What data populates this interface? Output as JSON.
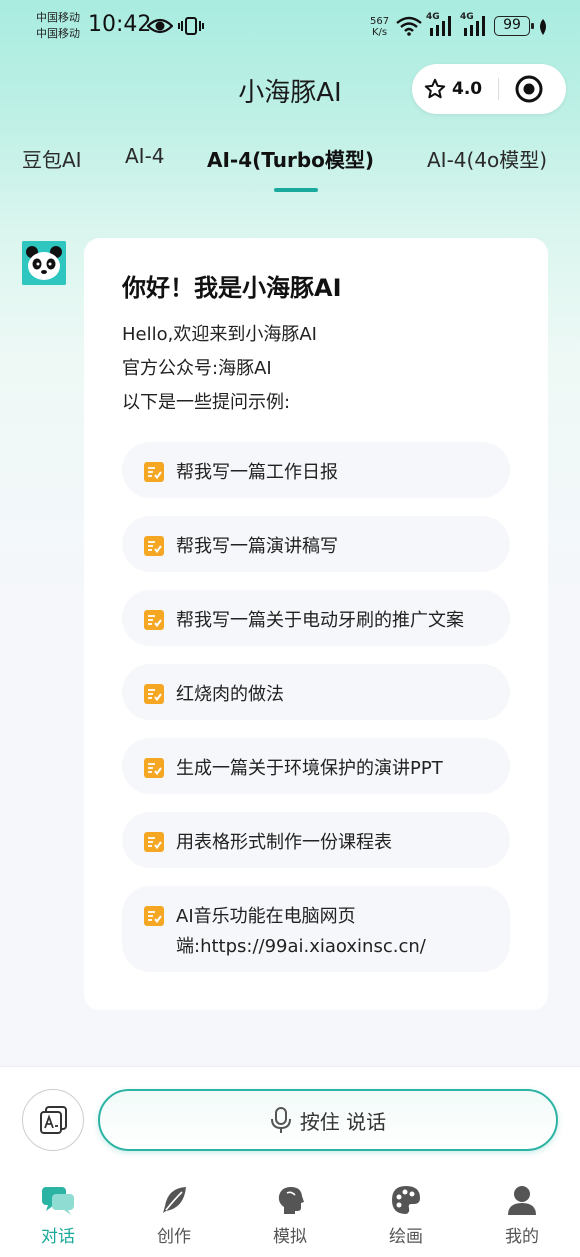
{
  "status_bar": {
    "carrier_1": "中国移动",
    "carrier_2": "中国移动",
    "time": "10:42",
    "net_speed_value": "567",
    "net_speed_unit": "K/s",
    "net_type_1": "4G",
    "net_type_2": "4G",
    "battery": "99"
  },
  "header": {
    "title": "小海豚AI",
    "rating": "4.0"
  },
  "tabs": [
    {
      "label": "豆包AI"
    },
    {
      "label": "AI-4"
    },
    {
      "label": "AI-4(Turbo模型)",
      "active": true
    },
    {
      "label": "AI-4(4o模型)"
    }
  ],
  "chat": {
    "greeting": "你好！我是小海豚AI",
    "intro_lines": [
      "Hello,欢迎来到小海豚AI",
      "官方公众号:海豚AI",
      "以下是一些提问示例:"
    ],
    "prompts": [
      "帮我写一篇工作日报",
      "帮我写一篇演讲稿写",
      "帮我写一篇关于电动牙刷的推广文案",
      "红烧肉的做法",
      "生成一篇关于环境保护的演讲PPT",
      "用表格形式制作一份课程表",
      "AI音乐功能在电脑网页端:https://99ai.xiaoxinsc.cn/"
    ],
    "prompt_7_line_1": "AI音乐功能在电脑网页",
    "prompt_7_line_2": "端:https://99ai.xiaoxinsc.cn/"
  },
  "input": {
    "voice_label": "按住 说话"
  },
  "bottom_nav": [
    {
      "label": "对话",
      "icon": "chat-icon",
      "active": true
    },
    {
      "label": "创作",
      "icon": "feather-icon"
    },
    {
      "label": "模拟",
      "icon": "head-icon"
    },
    {
      "label": "绘画",
      "icon": "palette-icon"
    },
    {
      "label": "我的",
      "icon": "person-icon"
    }
  ],
  "colors": {
    "accent": "#1aa99c",
    "prompt_icon": "#f5a623"
  }
}
